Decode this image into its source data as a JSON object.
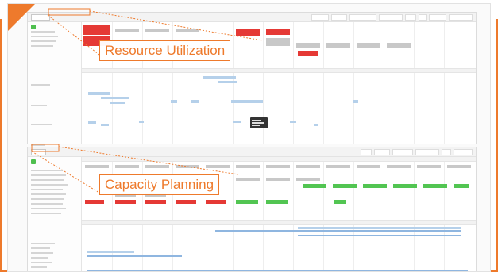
{
  "callouts": {
    "resource_utilization": "Resource Utilization",
    "capacity_planning": "Capacity Planning"
  },
  "accent_color": "#ee7a2c",
  "status_colors": {
    "over": "#e53935",
    "ok": "#52c552",
    "neutral": "#c8c8c8",
    "task": "#b5d0ea"
  },
  "icons": {
    "collapse": "green-square-icon"
  }
}
